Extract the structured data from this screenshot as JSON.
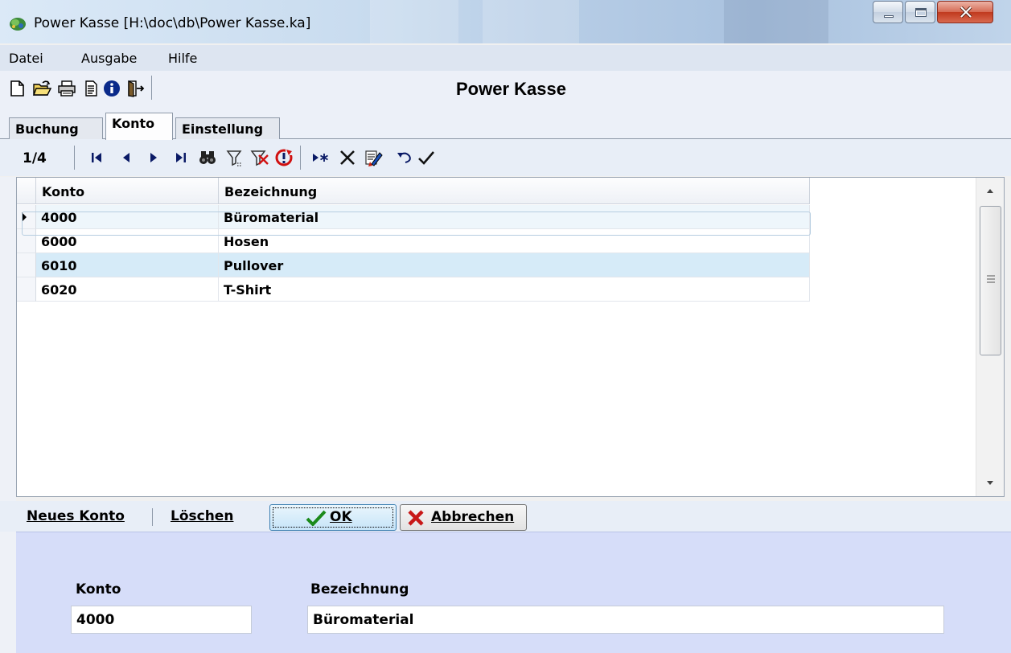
{
  "window": {
    "title": "Power Kasse   [H:\\doc\\db\\Power Kasse.ka]"
  },
  "menu": [
    "Datei",
    "Ausgabe",
    "Hilfe"
  ],
  "toolbar": {
    "heading": "Power Kasse",
    "icons": [
      "new-document-icon",
      "open-folder-icon",
      "printer-icon",
      "notepad-icon",
      "info-icon",
      "exit-door-icon"
    ]
  },
  "tabs": [
    {
      "label": "Buchung",
      "active": false
    },
    {
      "label": "Konto",
      "active": true
    },
    {
      "label": "Einstellung",
      "active": false
    }
  ],
  "navigator": {
    "counter": "1/4",
    "icons": [
      "first-record-icon",
      "prior-record-icon",
      "next-record-icon",
      "last-record-icon",
      "find-binoculars-icon",
      "filter-icon",
      "clear-filter-icon",
      "refresh-icon",
      "insert-record-icon",
      "delete-record-icon",
      "edit-record-icon",
      "cancel-edit-icon",
      "post-checkmark-icon"
    ]
  },
  "grid": {
    "columns": [
      "Konto",
      "Bezeichnung"
    ],
    "rows": [
      {
        "konto": "4000",
        "bezeichnung": "Büromaterial"
      },
      {
        "konto": "6000",
        "bezeichnung": "Hosen"
      },
      {
        "konto": "6010",
        "bezeichnung": "Pullover"
      },
      {
        "konto": "6020",
        "bezeichnung": "T-Shirt"
      }
    ],
    "selected_row": 0
  },
  "actions": {
    "new_account": "Neues Konto",
    "delete": "Löschen",
    "ok": "OK",
    "cancel": "Abbrechen"
  },
  "detail": {
    "konto_label": "Konto",
    "konto_value": "4000",
    "bezeichnung_label": "Bezeichnung",
    "bezeichnung_value": "Büromaterial"
  },
  "colors": {
    "detail_panel": "#d6ddf9",
    "alt_row": "#d6ebf8",
    "close_button": "#c0391e"
  }
}
